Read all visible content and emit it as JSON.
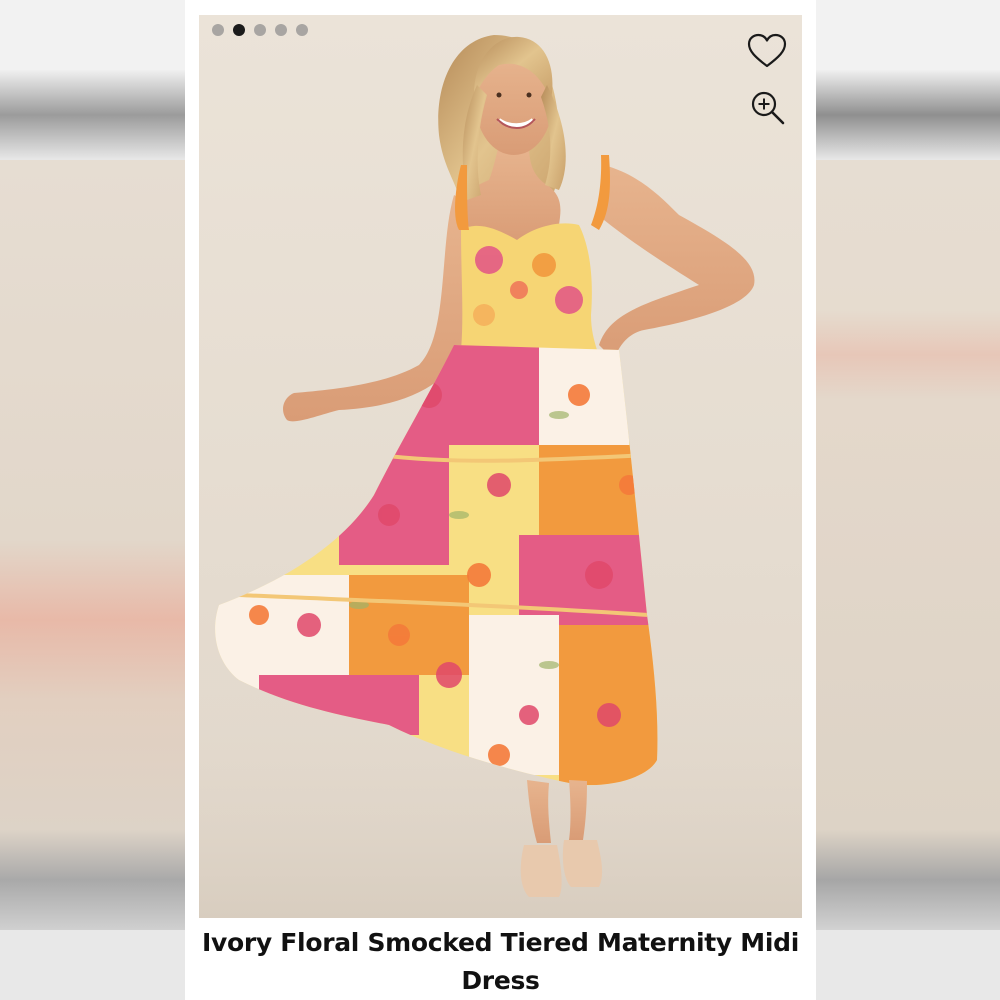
{
  "carousel": {
    "slides": 5,
    "active_index": 1
  },
  "actions": {
    "favorite_icon": "heart-icon",
    "zoom_icon": "zoom-in-icon"
  },
  "product": {
    "title": "Ivory Floral Smocked Tiered Maternity Midi Dress"
  },
  "colors": {
    "backdrop": "#e6ddd1",
    "dress_pink": "#e45c85",
    "dress_orange": "#f29a3e",
    "dress_yellow": "#f8df84",
    "dot_active": "#1b1b1b",
    "dot_inactive": "#a8a5a2"
  }
}
